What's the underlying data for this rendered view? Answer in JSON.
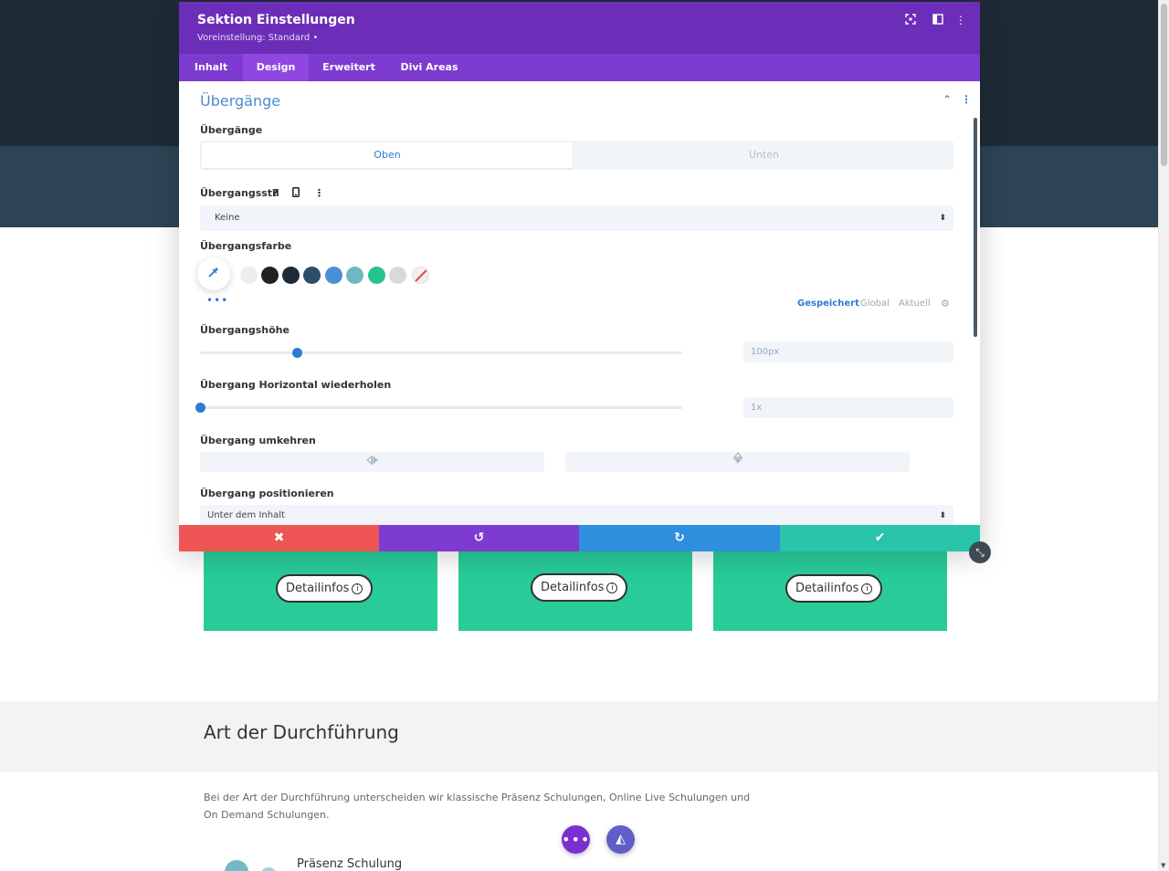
{
  "modal": {
    "title": "Sektion Einstellungen",
    "subtitle": "Voreinstellung: Standard •",
    "header_icons": [
      "fullscreen-icon",
      "split-view-icon",
      "more-vertical-icon"
    ],
    "tabs": [
      {
        "label": "Inhalt",
        "active": false
      },
      {
        "label": "Design",
        "active": true
      },
      {
        "label": "Erweitert",
        "active": false
      },
      {
        "label": "Divi Areas",
        "active": false
      }
    ]
  },
  "section": {
    "title": "Übergänge",
    "icons": [
      "chevron-up-icon",
      "more-vertical-icon"
    ]
  },
  "fields": {
    "uebergaenge": {
      "label": "Übergänge",
      "options": [
        "Oben",
        "Unten"
      ],
      "selected": "Oben"
    },
    "stil": {
      "label": "Übergangsstil",
      "help_glyph": "?",
      "more_glyph": "⋮",
      "value": "Keine",
      "arrow": "⬍"
    },
    "farbe": {
      "label": "Übergangsfarbe",
      "swatches": [
        "#ededed",
        "#222222",
        "#1e2b36",
        "#2c4d6c",
        "#4a90d6",
        "#71b7c2",
        "#26c48c",
        "#d9d9d9"
      ],
      "more": "•••",
      "palette_tabs": [
        "Gespeichert",
        "Global",
        "Aktuell"
      ],
      "palette_active": "Gespeichert"
    },
    "hoehe": {
      "label": "Übergangshöhe",
      "value": "100px",
      "slider_fraction": 0.2
    },
    "wiederholen": {
      "label": "Übergang Horizontal wiederholen",
      "value": "1x",
      "slider_fraction": 0.0
    },
    "umkehren": {
      "label": "Übergang umkehren",
      "icons": [
        "flip-horizontal-icon",
        "flip-vertical-icon"
      ]
    },
    "positionieren": {
      "label": "Übergang positionieren",
      "value": "Unter dem Inhalt",
      "arrow": "⬍"
    }
  },
  "footer": {
    "buttons": [
      {
        "name": "cancel",
        "glyph": "✖",
        "color": "#ef5555"
      },
      {
        "name": "undo",
        "glyph": "↺",
        "color": "#7e3bd0"
      },
      {
        "name": "redo",
        "glyph": "↻",
        "color": "#2f8fdf"
      },
      {
        "name": "save",
        "glyph": "✔",
        "color": "#29c4a9"
      }
    ]
  },
  "page": {
    "cards": [
      {
        "button": "Detailinfos",
        "info_glyph": "i"
      },
      {
        "button": "Detailinfos",
        "info_glyph": "i"
      },
      {
        "button": "Detailinfos",
        "info_glyph": "i"
      }
    ],
    "section_heading": "Art der Durchführung",
    "paragraph": "Bei der Art der Durchführung unterscheiden wir klassische Präsenz Schulungen, Online Live Schulungen und On Demand Schulungen.",
    "subheading": "Präsenz Schulung",
    "fab_dots": "•••",
    "fab_speed": "◭"
  },
  "colors": {
    "header_purple": "#6c2eb9",
    "tab_purple": "#7e3bd0",
    "accent_blue": "#2e7bd1",
    "card_green": "#29cc99"
  }
}
